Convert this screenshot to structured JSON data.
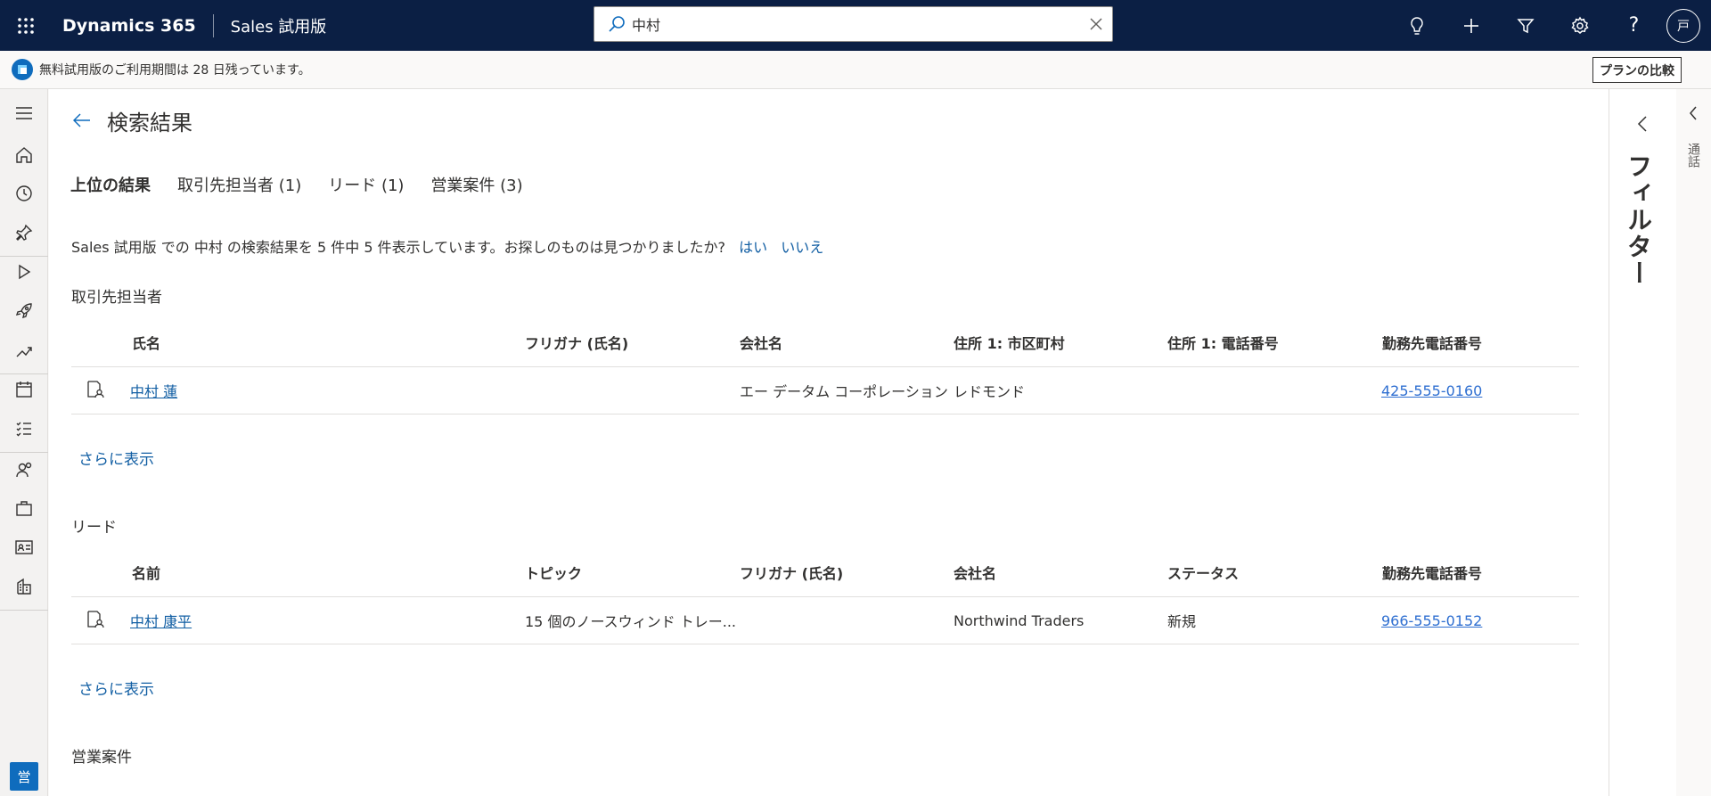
{
  "topbar": {
    "brand": "Dynamics 365",
    "app_name": "Sales 試用版",
    "search_value": "中村",
    "avatar_initial": "戸"
  },
  "notification": {
    "text": "無料試用版のご利用期間は 28 日残っています。",
    "plan_button": "プランの比較"
  },
  "leftnav": {
    "badge": "営"
  },
  "page": {
    "title": "検索結果",
    "tabs": [
      {
        "label": "上位の結果"
      },
      {
        "label": "取引先担当者 (1)"
      },
      {
        "label": "リード (1)"
      },
      {
        "label": "営業案件 (3)"
      }
    ],
    "summary": "Sales 試用版 での 中村 の検索結果を 5 件中 5 件表示しています。お探しのものは見つかりましたか?",
    "feedback_yes": "はい",
    "feedback_no": "いいえ",
    "show_more": "さらに表示"
  },
  "contacts": {
    "title": "取引先担当者",
    "columns": [
      "氏名",
      "フリガナ (氏名)",
      "会社名",
      "住所 1: 市区町村",
      "住所 1: 電話番号",
      "勤務先電話番号"
    ],
    "rows": [
      {
        "name": "中村 蓮",
        "furigana": "",
        "company": "エー データム コーポレーション",
        "city": "レドモンド",
        "phone": "",
        "work_phone": "425-555-0160"
      }
    ]
  },
  "leads": {
    "title": "リード",
    "columns": [
      "名前",
      "トピック",
      "フリガナ (氏名)",
      "会社名",
      "ステータス",
      "勤務先電話番号"
    ],
    "rows": [
      {
        "name": "中村 康平",
        "topic": "15 個のノースウィンド トレー...",
        "furigana": "",
        "company": "Northwind Traders",
        "status": "新規",
        "work_phone": "966-555-0152"
      }
    ]
  },
  "opportunities": {
    "title": "営業案件"
  },
  "filter_panel": {
    "label": "フィルター"
  },
  "call_panel": {
    "label": "通話"
  },
  "colors": {
    "topbar": "#0b1f44",
    "link": "#115ea3",
    "accent": "#0f6cbd"
  }
}
